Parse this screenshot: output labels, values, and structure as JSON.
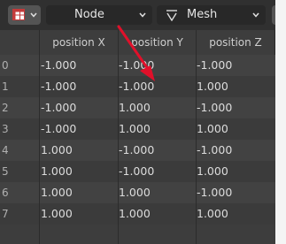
{
  "header": {
    "editor_type_icon": "spreadsheet-icon",
    "object_eval_dropdown": "Node",
    "domain_dropdown": "Mesh",
    "domain_icon": "geometry-vertex-icon"
  },
  "table": {
    "columns": [
      "position X",
      "position Y",
      "position Z"
    ],
    "rows": [
      {
        "index": "0",
        "x": "-1.000",
        "y": "-1.000",
        "z": "-1.000"
      },
      {
        "index": "1",
        "x": "-1.000",
        "y": "-1.000",
        "z": "1.000"
      },
      {
        "index": "2",
        "x": "-1.000",
        "y": "1.000",
        "z": "-1.000"
      },
      {
        "index": "3",
        "x": "-1.000",
        "y": "1.000",
        "z": "1.000"
      },
      {
        "index": "4",
        "x": "1.000",
        "y": "-1.000",
        "z": "-1.000"
      },
      {
        "index": "5",
        "x": "1.000",
        "y": "-1.000",
        "z": "1.000"
      },
      {
        "index": "6",
        "x": "1.000",
        "y": "1.000",
        "z": "-1.000"
      },
      {
        "index": "7",
        "x": "1.000",
        "y": "1.000",
        "z": "1.000"
      }
    ]
  },
  "annotation": {
    "type": "red-arrow",
    "color": "#e0102a"
  },
  "colors": {
    "editor_bg": "#3d3d3d",
    "header_bg": "#303030",
    "accent_red": "#cc3333"
  }
}
